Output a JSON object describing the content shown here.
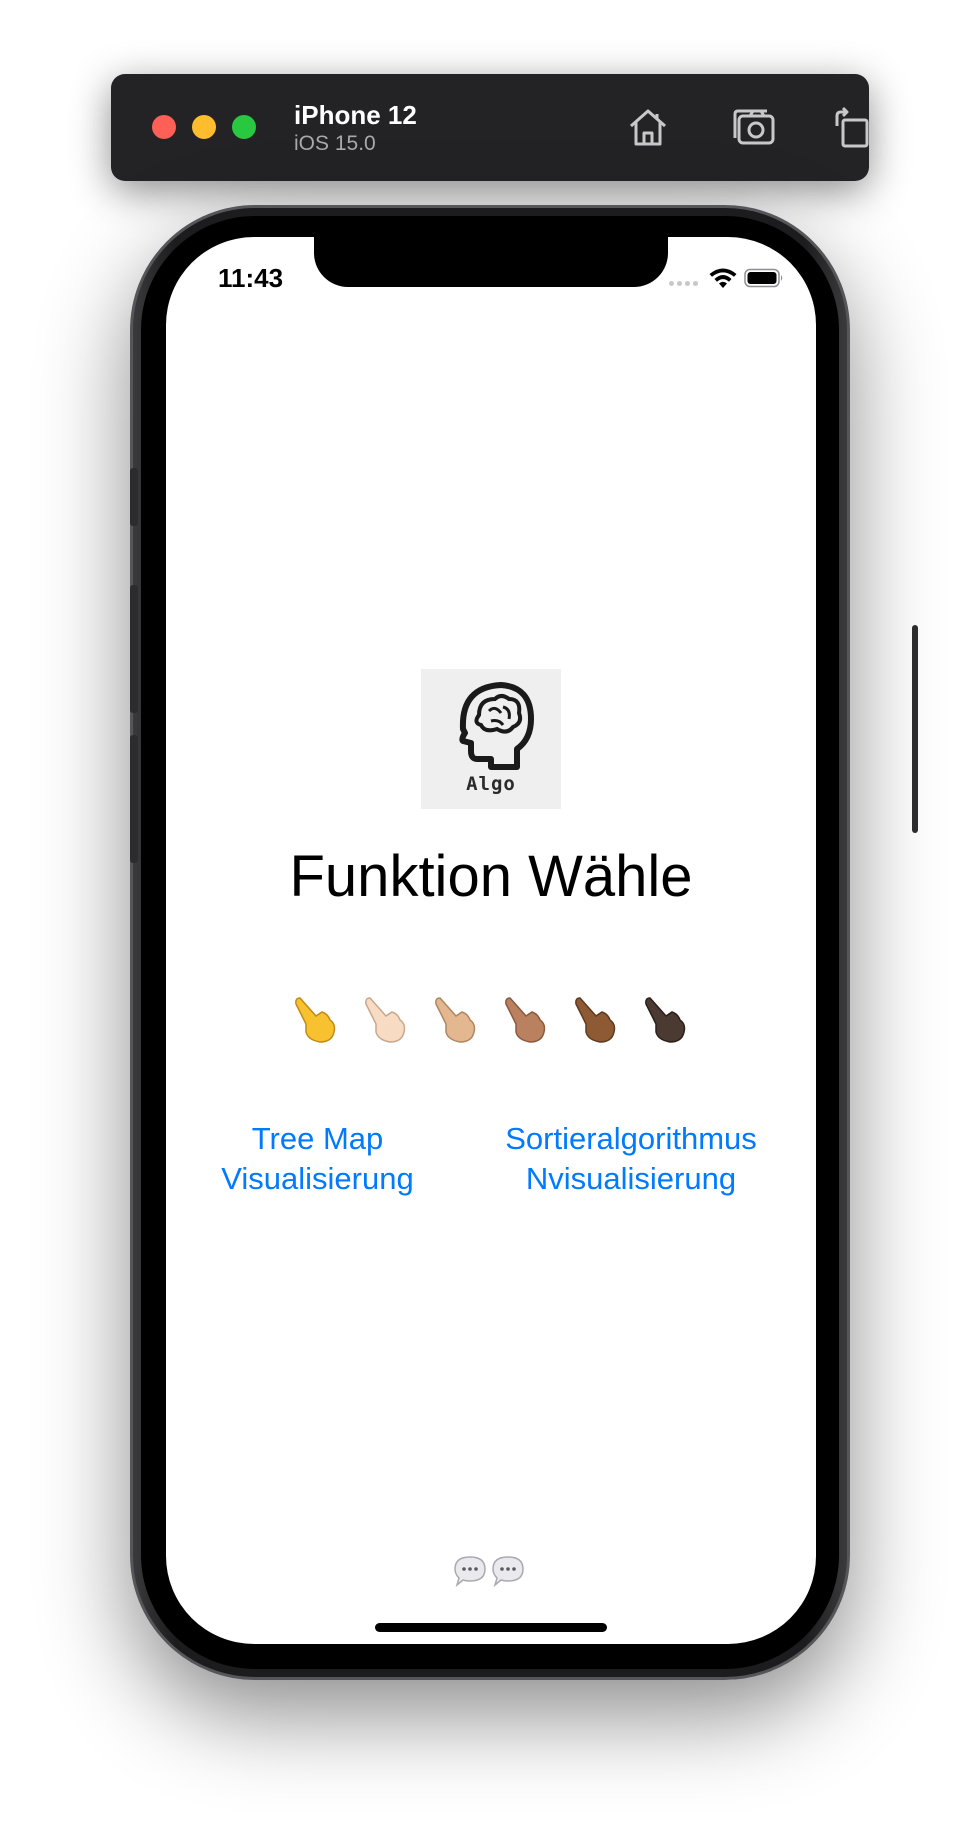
{
  "simulator": {
    "device_name": "iPhone 12",
    "os_version": "iOS 15.0",
    "toolbar": [
      "home-icon",
      "screenshot-icon",
      "rotate-icon"
    ]
  },
  "status_bar": {
    "time": "11:43"
  },
  "app": {
    "logo_text": "Algo",
    "title": "Funktion Wähle",
    "hands": [
      "pointing-hand-default",
      "pointing-hand-light",
      "pointing-hand-medium-light",
      "pointing-hand-medium",
      "pointing-hand-medium-dark",
      "pointing-hand-dark"
    ],
    "hand_colors": [
      "#f7c12f",
      "#f7dcc3",
      "#e3b78f",
      "#b98160",
      "#8e5a34",
      "#4b3a32"
    ],
    "options": [
      {
        "line1": "Tree Map",
        "line2": "Visualisierung"
      },
      {
        "line1": "Sortieralgorithmus",
        "line2": "Nvisualisierung"
      }
    ],
    "link_color": "#007aff"
  }
}
